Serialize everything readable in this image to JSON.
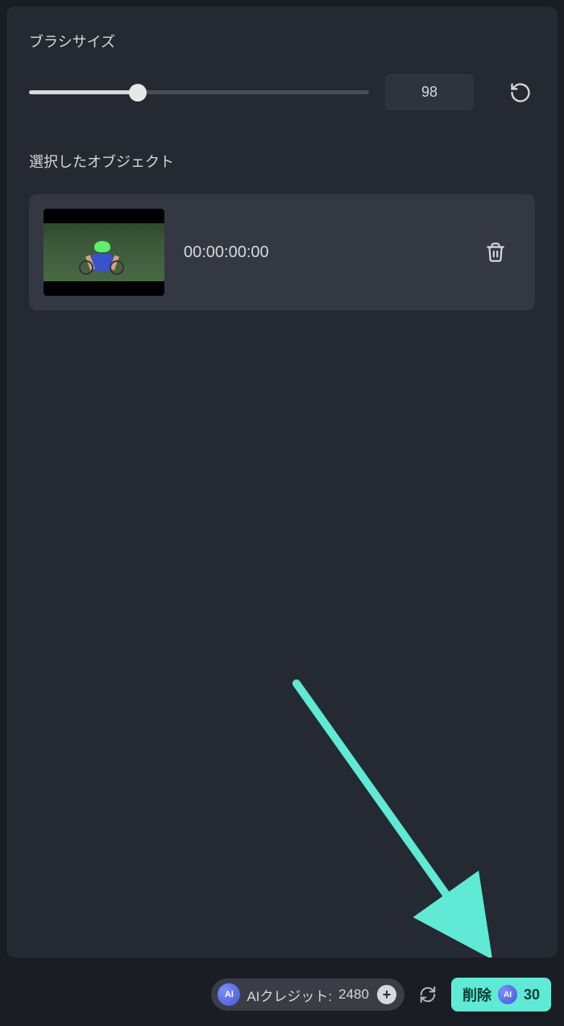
{
  "brush": {
    "label": "ブラシサイズ",
    "value": "98"
  },
  "objects": {
    "label": "選択したオブジェクト",
    "items": [
      {
        "timecode": "00:00:00:00"
      }
    ]
  },
  "footer": {
    "credit_label": "AIクレジット:",
    "credit_value": "2480",
    "delete_label": "削除",
    "delete_cost": "30",
    "ai_badge": "AI"
  }
}
